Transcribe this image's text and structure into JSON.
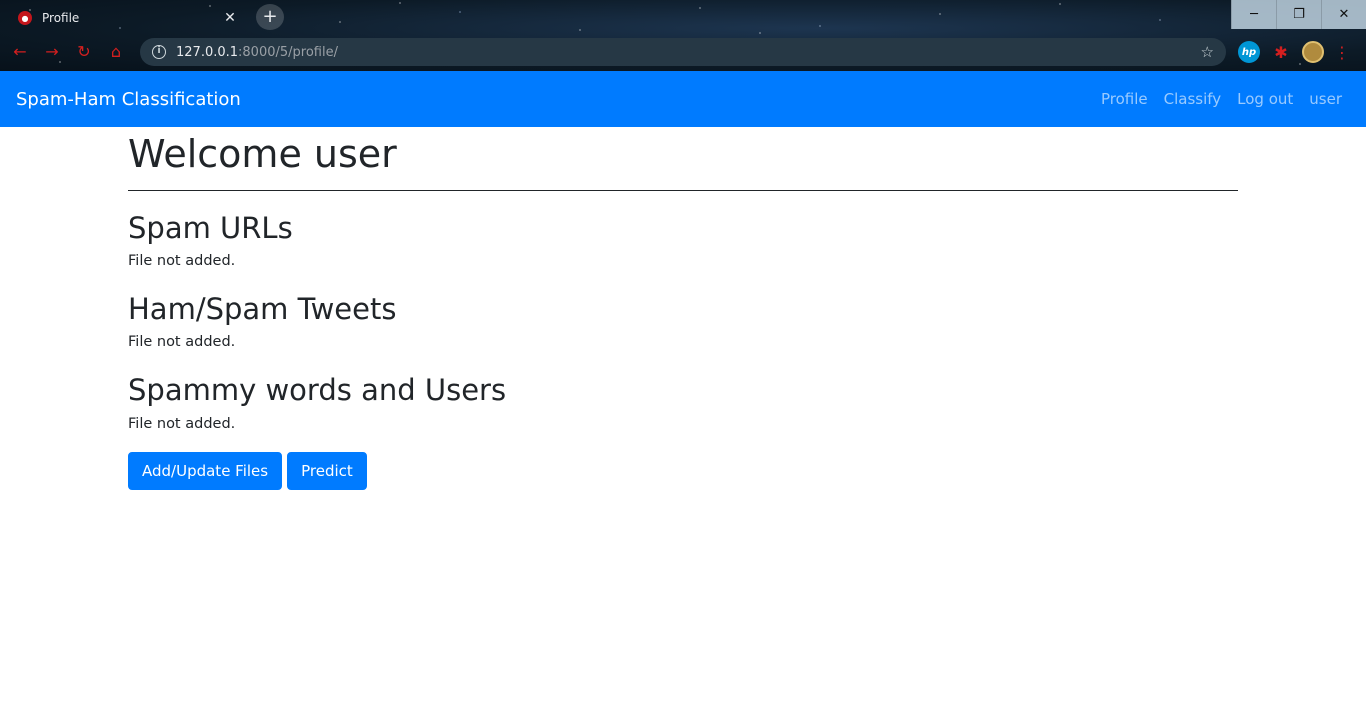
{
  "browser": {
    "tab_title": "Profile",
    "url_host": "127.0.0.1",
    "url_rest": ":8000/5/profile/",
    "hp_label": "hp"
  },
  "navbar": {
    "brand": "Spam-Ham Classification",
    "links": [
      "Profile",
      "Classify",
      "Log out",
      "user"
    ],
    "color": "#007bff"
  },
  "main": {
    "title": "Welcome user",
    "sections": [
      {
        "heading": "Spam URLs",
        "status": "File not added."
      },
      {
        "heading": "Ham/Spam Tweets",
        "status": "File not added."
      },
      {
        "heading": "Spammy words and Users",
        "status": "File not added."
      }
    ],
    "buttons": {
      "add_update": "Add/Update Files",
      "predict": "Predict"
    }
  }
}
